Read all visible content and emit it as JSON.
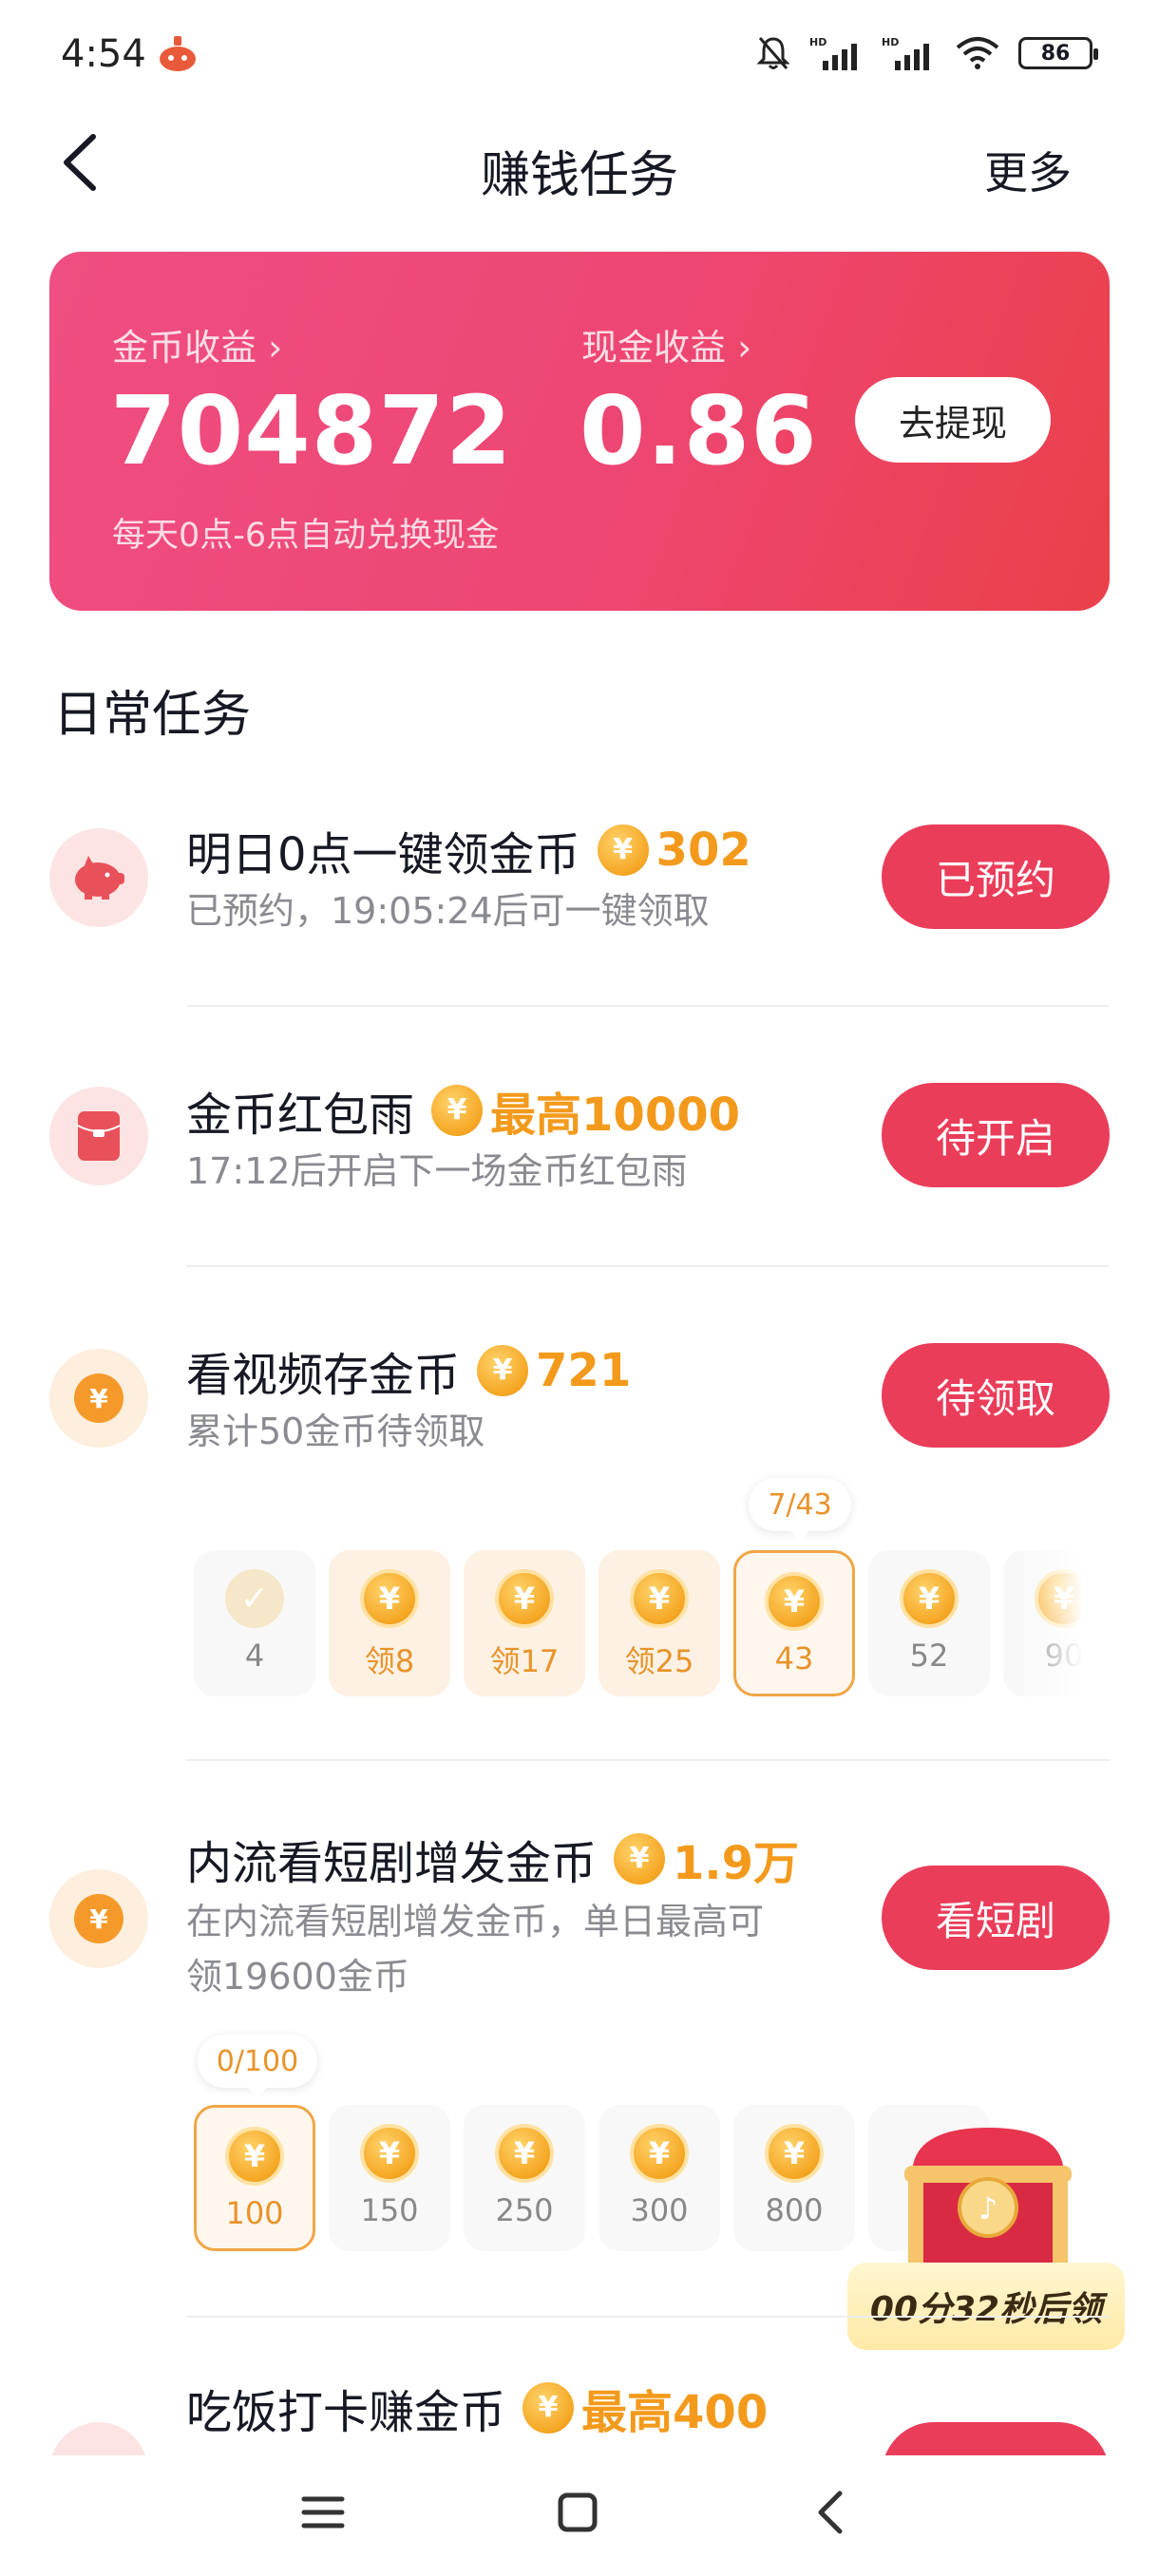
{
  "status_bar": {
    "time": "4:54",
    "battery": "86",
    "icons": [
      "app-notification-icon",
      "mute-bell-icon",
      "hd-signal-icon",
      "hd-signal-icon",
      "wifi-icon",
      "battery-icon"
    ]
  },
  "nav": {
    "title": "赚钱任务",
    "more": "更多"
  },
  "earnings": {
    "coin_label": "金币收益 ›",
    "coin_value": "704872",
    "cash_label": "现金收益 ›",
    "cash_value": "0.86",
    "withdraw": "去提现",
    "note": "每天0点-6点自动兑换现金"
  },
  "section_title": "日常任务",
  "tasks": [
    {
      "title": "明日0点一键领金币",
      "reward": "302",
      "sub": "已预约，19:05:24后可一键领取",
      "button": "已预约",
      "icon": "piggy-bank-icon"
    },
    {
      "title": "金币红包雨",
      "reward": "最高10000",
      "sub": "17:12后开启下一场金币红包雨",
      "button": "待开启",
      "icon": "red-envelope-icon"
    },
    {
      "title": "看视频存金币",
      "reward": "721",
      "sub": "累计50金币待领取",
      "button": "待领取",
      "icon": "yuan-coin-icon",
      "progress_bubble": "7/43",
      "coins": [
        {
          "label": "4",
          "state": "done"
        },
        {
          "label": "领8",
          "state": "claimable"
        },
        {
          "label": "领17",
          "state": "claimable"
        },
        {
          "label": "领25",
          "state": "claimable"
        },
        {
          "label": "43",
          "state": "current"
        },
        {
          "label": "52",
          "state": "locked"
        },
        {
          "label": "90",
          "state": "locked"
        }
      ]
    },
    {
      "title": "内流看短剧增发金币",
      "reward": "1.9万",
      "sub_line1": "在内流看短剧增发金币，单日最高可",
      "sub_line2": "领19600金币",
      "button": "看短剧",
      "icon": "yuan-coin-icon",
      "progress_bubble": "0/100",
      "coins": [
        {
          "label": "100",
          "state": "current"
        },
        {
          "label": "150",
          "state": "locked"
        },
        {
          "label": "250",
          "state": "locked"
        },
        {
          "label": "300",
          "state": "locked"
        },
        {
          "label": "800",
          "state": "locked"
        }
      ]
    },
    {
      "title": "吃饭打卡赚金币",
      "reward": "最高400"
    }
  ],
  "chest": {
    "countdown": "00分32秒后领"
  },
  "coin_symbol": "¥",
  "colors": {
    "accent_red": "#ea3d5a",
    "coin_orange": "#f39a1c",
    "card_gradient_start": "#ef4e82",
    "card_gradient_end": "#ea4049"
  }
}
